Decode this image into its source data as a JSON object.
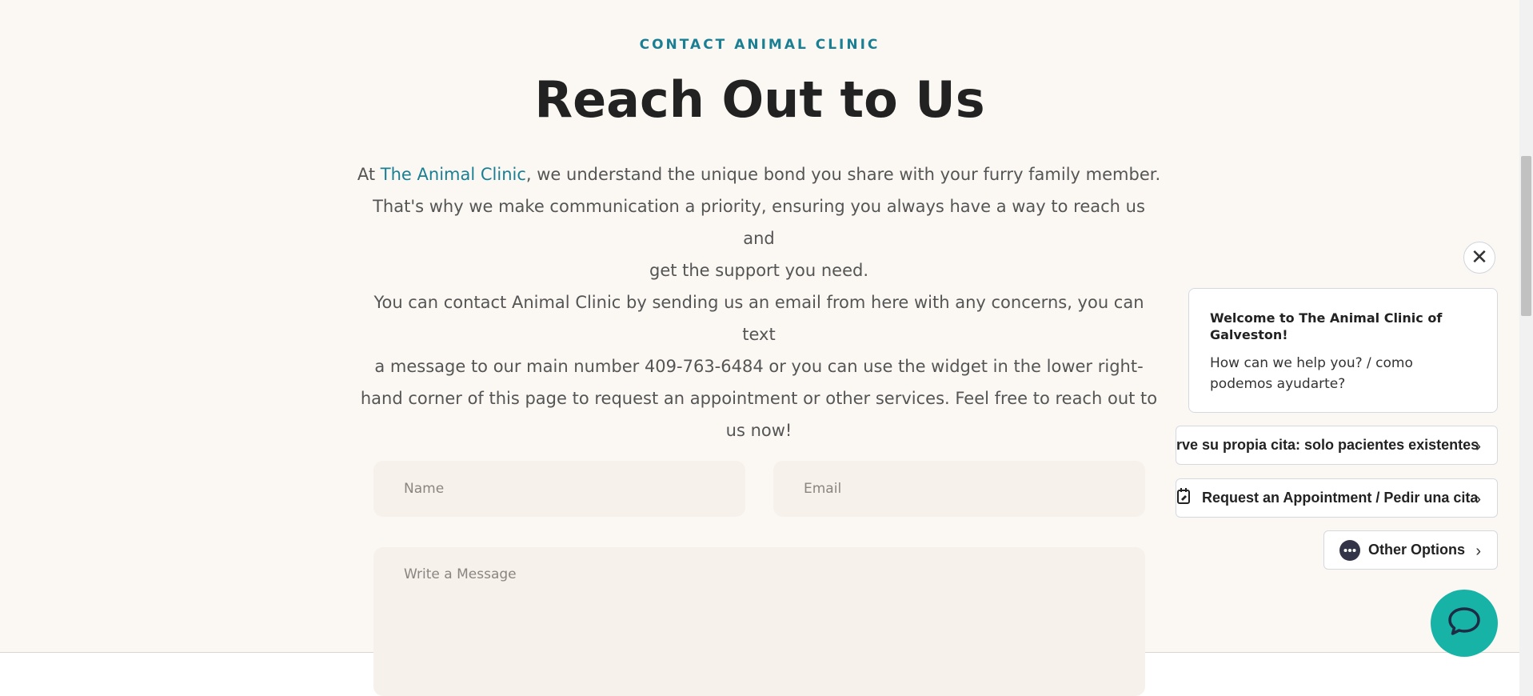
{
  "section": {
    "eyebrow": "CONTACT ANIMAL CLINIC",
    "title": "Reach Out to Us",
    "intro_prefix": "At ",
    "intro_link": "The Animal Clinic",
    "intro_line1_rest": ", we understand the unique bond you share with your furry family member.",
    "intro_line2": "That's why we make communication a priority, ensuring you always have a way to reach us and",
    "intro_line3": "get the support you need.",
    "contact_line1": "You can contact Animal Clinic by sending us an email from here with any concerns, you can text",
    "contact_line2": "a message to our main number 409-763-6484 or you can use the widget in the lower right-",
    "contact_line3": "hand corner of this page to request an appointment or other services. Feel free to reach out to",
    "contact_line4": "us now!"
  },
  "form": {
    "name_placeholder": "Name",
    "email_placeholder": "Email",
    "message_placeholder": "Write a Message"
  },
  "chat_widget": {
    "welcome_title": "Welcome to The Animal Clinic of Galveston!",
    "welcome_body": "How can we help you? / como podemos ayudarte?",
    "options": [
      {
        "label": "rve su propia cita: solo pacientes existentes",
        "icon": "calendar-icon"
      },
      {
        "label": "Request an Appointment / Pedir una cita",
        "icon": "calendar-edit-icon"
      },
      {
        "label": "Other Options",
        "icon": "more-icon"
      }
    ],
    "close_icon": "close-icon",
    "launcher_icon": "chat-bubble-icon",
    "accent_color": "#17b3a6"
  },
  "colors": {
    "link": "#1a7f93",
    "background": "#fbf8f4",
    "field": "#f6f1ea"
  }
}
